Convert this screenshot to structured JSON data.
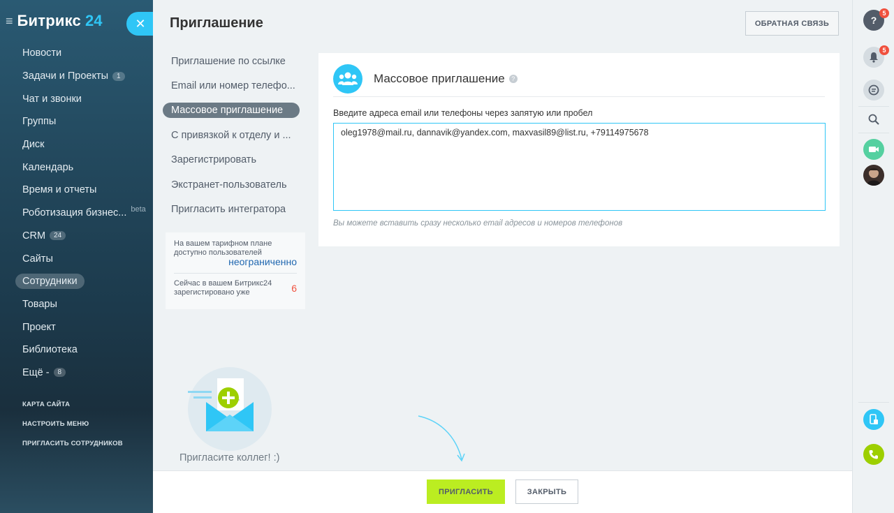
{
  "sidebar": {
    "brand_name": "Битрикс",
    "brand_num": "24",
    "items": [
      {
        "label": "Новости"
      },
      {
        "label": "Задачи и Проекты",
        "badge": "1"
      },
      {
        "label": "Чат и звонки"
      },
      {
        "label": "Группы"
      },
      {
        "label": "Диск"
      },
      {
        "label": "Календарь"
      },
      {
        "label": "Время и отчеты"
      },
      {
        "label": "Роботизация бизнес...",
        "beta": "beta"
      },
      {
        "label": "CRM",
        "badge": "24"
      },
      {
        "label": "Сайты"
      },
      {
        "label": "Сотрудники"
      },
      {
        "label": "Товары"
      },
      {
        "label": "Проект"
      },
      {
        "label": "Библиотека"
      },
      {
        "label": "Ещё -",
        "badge": "8"
      }
    ],
    "links": [
      "КАРТА САЙТА",
      "НАСТРОИТЬ МЕНЮ",
      "ПРИГЛАСИТЬ СОТРУДНИКОВ"
    ]
  },
  "panel": {
    "title": "Приглашение",
    "feedback_label": "ОБРАТНАЯ СВЯЗЬ",
    "tabs": [
      "Приглашение по ссылке",
      "Email или номер телефо...",
      "Массовое приглашение",
      "С привязкой к отделу и ...",
      "Зарегистрировать",
      "Экстранет-пользователь",
      "Пригласить интегратора"
    ],
    "limits": {
      "plan_text": "На вашем тарифном плане доступно пользователей",
      "plan_value": "неограниченно",
      "registered_text": "Сейчас в вашем Битрикс24 зарегистировано уже",
      "registered_value": "6"
    },
    "invite_caption": "Пригласите коллег! :)",
    "card": {
      "title": "Массовое приглашение",
      "help": "?",
      "field_label": "Введите адреса email или телефоны через запятую или пробел",
      "emails_value": "oleg1978@mail.ru, dannavik@yandex.com, maxvasil89@list.ru, +79114975678",
      "hint": "Вы можете вставить сразу несколько email адресов и номеров телефонов"
    },
    "footer": {
      "invite_label": "ПРИГЛАСИТЬ",
      "close_label": "ЗАКРЫТЬ"
    }
  },
  "rightbar": {
    "help_badge": "5",
    "notif_badge": "5"
  },
  "colors": {
    "accent": "#2fc6f6",
    "invite_button": "#bbed21",
    "badge": "#f0513e",
    "call": "#9dcf00"
  }
}
